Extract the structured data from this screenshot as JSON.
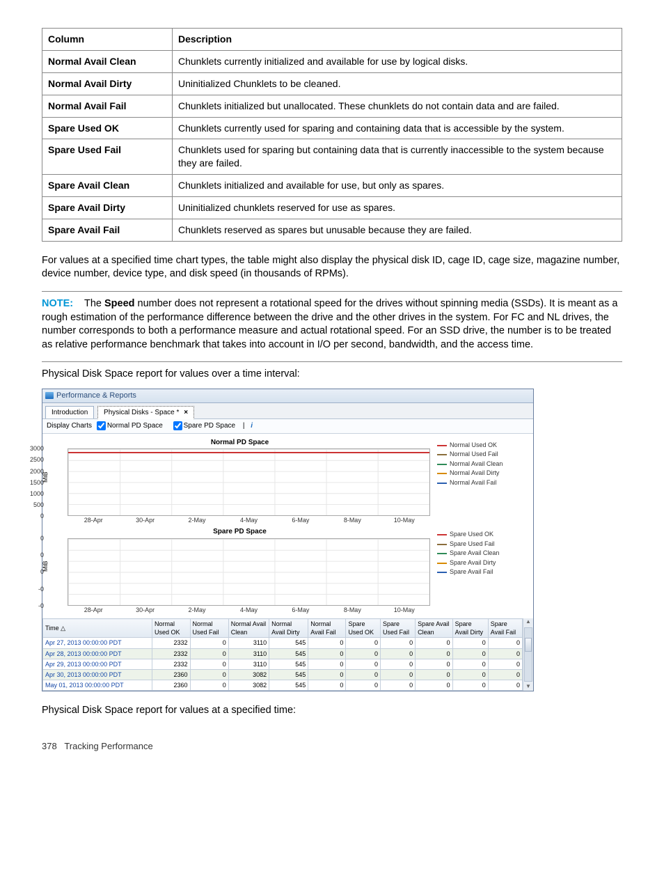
{
  "defs_table": {
    "headers": [
      "Column",
      "Description"
    ],
    "rows": [
      [
        "Normal Avail Clean",
        "Chunklets currently initialized and available for use by logical disks."
      ],
      [
        "Normal Avail Dirty",
        "Uninitialized Chunklets to be cleaned."
      ],
      [
        "Normal Avail Fail",
        "Chunklets initialized but unallocated. These chunklets do not contain data and are failed."
      ],
      [
        "Spare Used OK",
        "Chunklets currently used for sparing and containing data that is accessible by the system."
      ],
      [
        "Spare Used Fail",
        "Chunklets used for sparing but containing data that is currently inaccessible to the system because they are failed."
      ],
      [
        "Spare Avail Clean",
        "Chunklets initialized and available for use, but only as spares."
      ],
      [
        "Spare Avail Dirty",
        "Uninitialized chunklets reserved for use as spares."
      ],
      [
        "Spare Avail Fail",
        "Chunklets reserved as spares but unusable because they are failed."
      ]
    ]
  },
  "para1": "For values at a specified time chart types, the table might also display the physical disk ID, cage ID, cage size, magazine number, device number, device type, and disk speed (in thousands of RPMs).",
  "note": {
    "label": "NOTE:",
    "bold": "Speed",
    "before": "The ",
    "after": " number does not represent a rotational speed for the drives without spinning media (SSDs). It is meant as a rough estimation of the performance difference between the drive and the other drives in the system. For FC and NL drives, the number corresponds to both a performance measure and actual rotational speed. For an SSD drive, the number is to be treated as relative performance benchmark that takes into account in I/O per second, bandwidth, and the access time."
  },
  "caption_interval": "Physical Disk Space report for values over a time interval:",
  "caption_specified": "Physical Disk Space report for values at a specified time:",
  "shot": {
    "window_title": "Performance & Reports",
    "tabs": {
      "intro": "Introduction",
      "active": "Physical Disks - Space *",
      "close": "×"
    },
    "toolbar": {
      "label": "Display Charts",
      "cb1": "Normal PD Space",
      "cb2": "Spare PD Space",
      "info": "i"
    },
    "chart1": {
      "title": "Normal PD Space",
      "ylabel": "MiB",
      "yticks": [
        "3000",
        "2500",
        "2000",
        "1500",
        "1000",
        "500",
        "0"
      ],
      "xticks": [
        "28-Apr",
        "30-Apr",
        "2-May",
        "4-May",
        "6-May",
        "8-May",
        "10-May"
      ],
      "legend": [
        "Normal Used OK",
        "Normal Used Fail",
        "Normal Avail Clean",
        "Normal Avail Dirty",
        "Normal Avail Fail"
      ]
    },
    "chart2": {
      "title": "Spare PD Space",
      "ylabel": "MiB",
      "yticks": [
        "0",
        "0",
        "0",
        "-0",
        "-0"
      ],
      "xticks": [
        "28-Apr",
        "30-Apr",
        "2-May",
        "4-May",
        "6-May",
        "8-May",
        "10-May"
      ],
      "legend": [
        "Spare Used OK",
        "Spare Used Fail",
        "Spare Avail Clean",
        "Spare Avail Dirty",
        "Spare Avail Fail"
      ]
    },
    "data_headers": [
      "Time",
      "Normal Used OK",
      "Normal Used Fail",
      "Normal Avail Clean",
      "Normal Avail Dirty",
      "Normal Avail Fail",
      "Spare Used OK",
      "Spare Used Fail",
      "Spare Avail Clean",
      "Spare Avail Dirty",
      "Spare Avail Fail"
    ],
    "sort_indicator": "△",
    "data_rows": [
      [
        "Apr 27, 2013 00:00:00 PDT",
        "2332",
        "0",
        "3110",
        "545",
        "0",
        "0",
        "0",
        "0",
        "0",
        "0"
      ],
      [
        "Apr 28, 2013 00:00:00 PDT",
        "2332",
        "0",
        "3110",
        "545",
        "0",
        "0",
        "0",
        "0",
        "0",
        "0"
      ],
      [
        "Apr 29, 2013 00:00:00 PDT",
        "2332",
        "0",
        "3110",
        "545",
        "0",
        "0",
        "0",
        "0",
        "0",
        "0"
      ],
      [
        "Apr 30, 2013 00:00:00 PDT",
        "2360",
        "0",
        "3082",
        "545",
        "0",
        "0",
        "0",
        "0",
        "0",
        "0"
      ],
      [
        "May 01, 2013 00:00:00 PDT",
        "2360",
        "0",
        "3082",
        "545",
        "0",
        "0",
        "0",
        "0",
        "0",
        "0"
      ]
    ]
  },
  "footer": {
    "page": "378",
    "section": "Tracking Performance"
  },
  "chart_data": [
    {
      "type": "line",
      "title": "Normal PD Space",
      "xlabel": "",
      "ylabel": "MiB",
      "x": [
        "28-Apr",
        "30-Apr",
        "2-May",
        "4-May",
        "6-May",
        "8-May",
        "10-May"
      ],
      "ylim": [
        0,
        3000
      ],
      "series": [
        {
          "name": "Normal Used OK",
          "values": [
            2332,
            2332,
            2332,
            2360,
            2360,
            2360,
            2360
          ]
        },
        {
          "name": "Normal Used Fail",
          "values": [
            0,
            0,
            0,
            0,
            0,
            0,
            0
          ]
        },
        {
          "name": "Normal Avail Clean",
          "values": [
            3110,
            3110,
            3110,
            3082,
            3082,
            3082,
            3082
          ]
        },
        {
          "name": "Normal Avail Dirty",
          "values": [
            545,
            545,
            545,
            545,
            545,
            545,
            545
          ]
        },
        {
          "name": "Normal Avail Fail",
          "values": [
            0,
            0,
            0,
            0,
            0,
            0,
            0
          ]
        }
      ]
    },
    {
      "type": "line",
      "title": "Spare PD Space",
      "xlabel": "",
      "ylabel": "MiB",
      "x": [
        "28-Apr",
        "30-Apr",
        "2-May",
        "4-May",
        "6-May",
        "8-May",
        "10-May"
      ],
      "ylim": [
        0,
        0
      ],
      "series": [
        {
          "name": "Spare Used OK",
          "values": [
            0,
            0,
            0,
            0,
            0,
            0,
            0
          ]
        },
        {
          "name": "Spare Used Fail",
          "values": [
            0,
            0,
            0,
            0,
            0,
            0,
            0
          ]
        },
        {
          "name": "Spare Avail Clean",
          "values": [
            0,
            0,
            0,
            0,
            0,
            0,
            0
          ]
        },
        {
          "name": "Spare Avail Dirty",
          "values": [
            0,
            0,
            0,
            0,
            0,
            0,
            0
          ]
        },
        {
          "name": "Spare Avail Fail",
          "values": [
            0,
            0,
            0,
            0,
            0,
            0,
            0
          ]
        }
      ]
    }
  ]
}
